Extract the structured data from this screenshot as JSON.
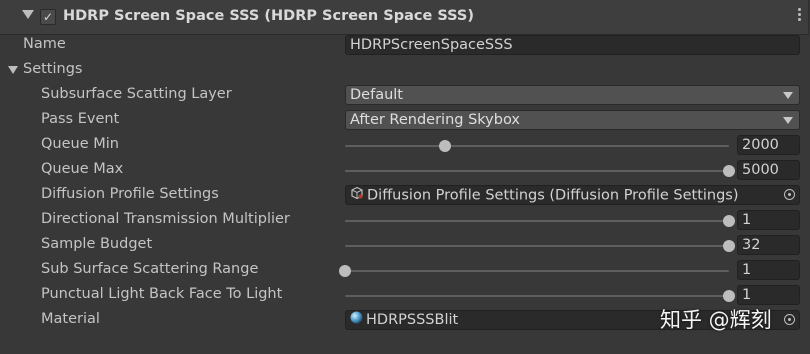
{
  "header": {
    "title": "HDRP Screen Space SSS (HDRP Screen Space SSS)",
    "enabled": true
  },
  "name_row": {
    "label": "Name",
    "value": "HDRPScreenSpaceSSS"
  },
  "settings": {
    "label": "Settings",
    "subsurface_layer": {
      "label": "Subsurface Scatting Layer",
      "value": "Default"
    },
    "pass_event": {
      "label": "Pass Event",
      "value": "After Rendering Skybox"
    },
    "queue_min": {
      "label": "Queue Min",
      "value": "2000",
      "slider_level": 0.26
    },
    "queue_max": {
      "label": "Queue Max",
      "value": "5000",
      "slider_level": 1.0
    },
    "diffusion_profile": {
      "label": "Diffusion Profile Settings",
      "value": "Diffusion Profile Settings (Diffusion Profile Settings)"
    },
    "directional_transmission": {
      "label": "Directional Transmission Multiplier",
      "value": "1",
      "slider_level": 1.0
    },
    "sample_budget": {
      "label": "Sample Budget",
      "value": "32",
      "slider_level": 1.0
    },
    "scattering_range": {
      "label": "Sub Surface Scattering Range",
      "value": "1",
      "slider_level": 0.0
    },
    "punctual_light": {
      "label": "Punctual Light Back Face To Light",
      "value": "1",
      "slider_level": 1.0
    },
    "material": {
      "label": "Material",
      "value": "HDRPSSSBlit"
    }
  },
  "watermark": "知乎 @辉刻",
  "icons": {
    "foldout": "triangle-down-icon",
    "toggle": "checkmark-icon",
    "menu": "kebab-menu-icon",
    "object_picker": "object-picker-icon",
    "asset": "scriptable-object-icon",
    "material": "material-sphere-icon"
  },
  "colors": {
    "background": "#383838",
    "header": "#3e3e3e",
    "field": "#2a2a2a",
    "dropdown": "#515151",
    "text": "#c4c4c4"
  }
}
